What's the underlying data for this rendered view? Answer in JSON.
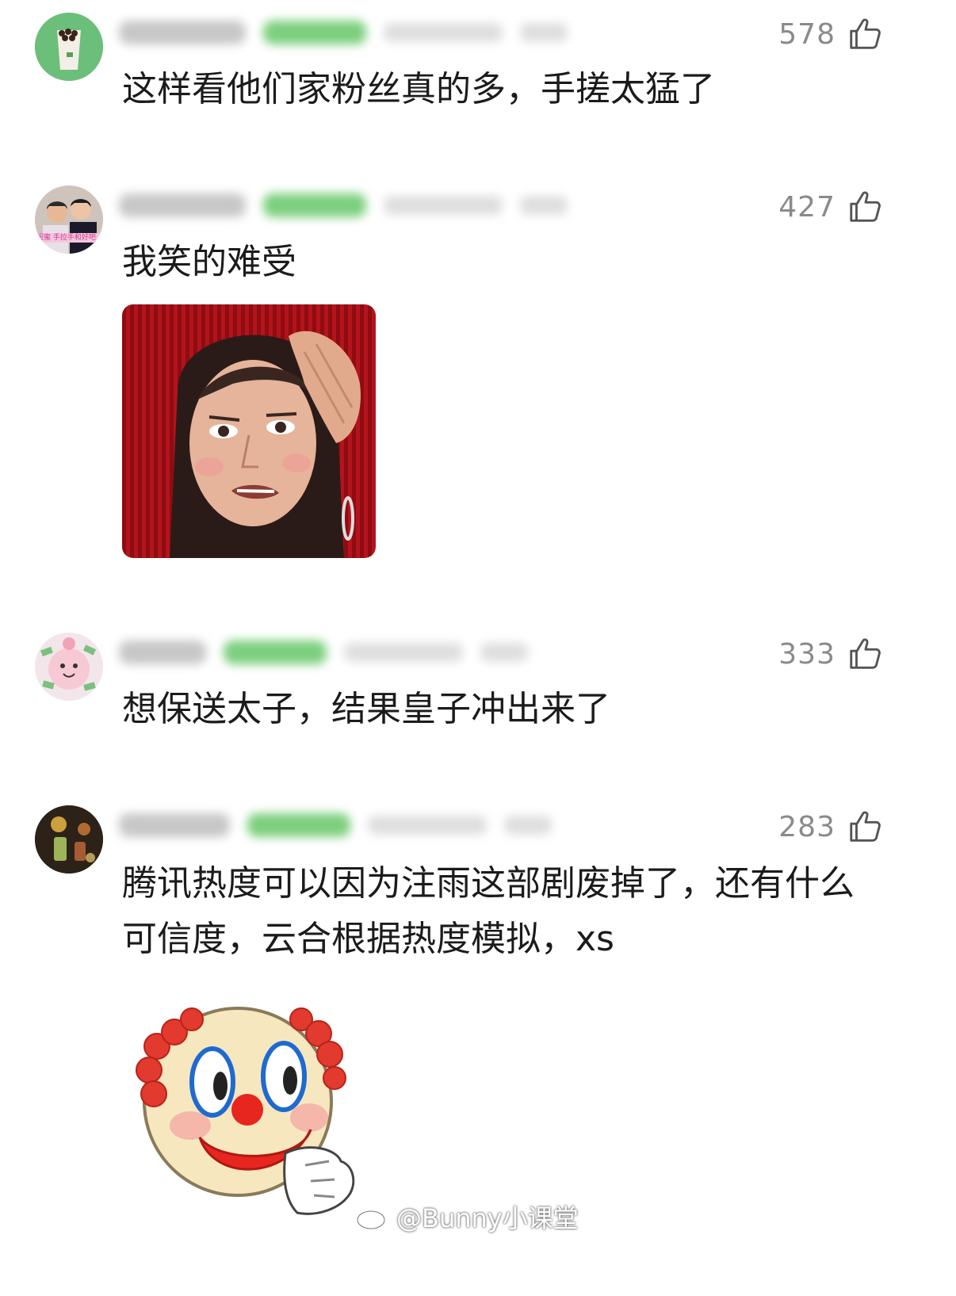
{
  "comments": [
    {
      "likes": "578",
      "text": "这样看他们家粉丝真的多，手搓太猛了",
      "avatar_icon": "milk-tea-cup-icon"
    },
    {
      "likes": "427",
      "text": "我笑的难受",
      "avatar_icon": "two-men-photo-icon",
      "avatar_caption": "闺蜜 手拉手和好吧",
      "sticker": "shocked-woman-reaction-sticker"
    },
    {
      "likes": "333",
      "text": "想保送太子，结果皇子冲出来了",
      "avatar_icon": "pink-cartoon-money-icon"
    },
    {
      "likes": "283",
      "text_line1": "腾讯热度可以因为注雨这部剧废掉了，还有什么",
      "text_line2": "可信度，云合根据热度模拟，xs",
      "avatar_icon": "cocktail-bar-photo-icon",
      "sticker": "clown-face-sticker"
    }
  ],
  "watermark": {
    "text": "@Bunny小课堂",
    "icon": "weibo-icon"
  },
  "colors": {
    "like_text": "#8a8a8a",
    "comment_text": "#1b1b1b",
    "badge_green": "#7ccf7d"
  }
}
